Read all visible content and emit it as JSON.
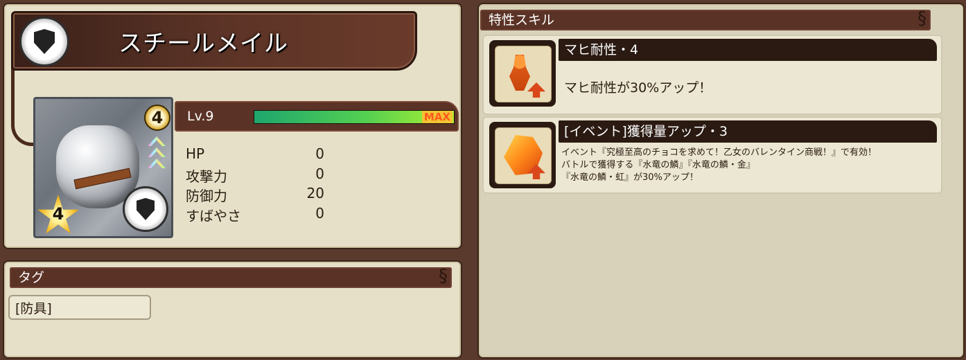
{
  "item": {
    "name": "スチールメイル",
    "level_badge": "4",
    "star_rank": "4"
  },
  "level": {
    "label": "Lv.9",
    "max_label": "MAX",
    "progress": 1.0
  },
  "stats": [
    {
      "label": "HP",
      "value": "0"
    },
    {
      "label": "攻撃力",
      "value": "0"
    },
    {
      "label": "防御力",
      "value": "20"
    },
    {
      "label": "すばやさ",
      "value": "0"
    }
  ],
  "tags": {
    "header": "タグ",
    "items": [
      "[防具]"
    ]
  },
  "skills": {
    "header": "特性スキル",
    "items": [
      {
        "title": "マヒ耐性・4",
        "icon": "paralysis-resist-icon",
        "desc": [
          "マヒ耐性が30%アップ！"
        ]
      },
      {
        "title": "[イベント]獲得量アップ・3",
        "icon": "gem-up-icon",
        "desc": [
          "イベント『究極至高のチョコを求めて！乙女のバレンタイン商戦！』で有効！",
          "バトルで獲得する『水竜の鱗』『水竜の鱗・金』",
          "『水竜の鱗・虹』が30%アップ！"
        ]
      }
    ]
  },
  "colors": {
    "panel": "#e6e0c8",
    "header": "#5b3326",
    "bar_start": "#1ea66e",
    "bar_end": "#aef030"
  }
}
